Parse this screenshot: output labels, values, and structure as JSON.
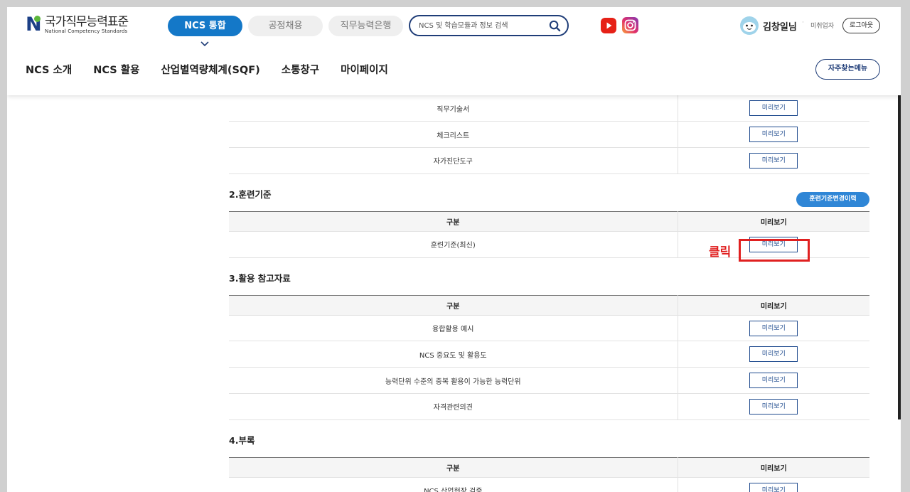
{
  "logo": {
    "title": "국가직무능력표준",
    "subtitle": "National Competency Standards"
  },
  "top_tabs": [
    {
      "label": "NCS 통합"
    },
    {
      "label": "공정채용"
    },
    {
      "label": "직무능력은행"
    }
  ],
  "search": {
    "placeholder": "NCS 및 학습모듈과 정보 검색"
  },
  "user": {
    "name": "김창일님",
    "status": "미취업자",
    "logout_label": "로그아웃"
  },
  "gnb": [
    {
      "label": "NCS 소개"
    },
    {
      "label": "NCS 활용"
    },
    {
      "label": "산업별역량체계(SQF)"
    },
    {
      "label": "소통창구"
    },
    {
      "label": "마이페이지"
    }
  ],
  "faq_label": "자주찾는메뉴",
  "preview_label": "미리보기",
  "section1": {
    "rows": [
      {
        "name": "직무기술서"
      },
      {
        "name": "체크리스트"
      },
      {
        "name": "자가진단도구"
      }
    ]
  },
  "section2": {
    "title": "2.훈련기준",
    "history_button": "훈련기준변경이력",
    "headers": {
      "category": "구분",
      "preview": "미리보기"
    },
    "rows": [
      {
        "name": "훈련기준(최신)"
      }
    ]
  },
  "section3": {
    "title": "3.활용 참고자료",
    "headers": {
      "category": "구분",
      "preview": "미리보기"
    },
    "rows": [
      {
        "name": "융합활용 예시"
      },
      {
        "name": "NCS 중요도 및 활용도"
      },
      {
        "name": "능력단위 수준의 중복 활용이 가능한 능력단위"
      },
      {
        "name": "자격관련의견"
      }
    ]
  },
  "section4": {
    "title": "4.부록",
    "headers": {
      "category": "구분",
      "preview": "미리보기"
    },
    "rows": [
      {
        "name": "NCS 산업현장 검증"
      }
    ]
  },
  "annotation": {
    "text": "클릭",
    "color": "#e02020"
  },
  "colors": {
    "primary": "#1478c8",
    "navy": "#1f3d78",
    "accent_button": "#2f86d6"
  }
}
